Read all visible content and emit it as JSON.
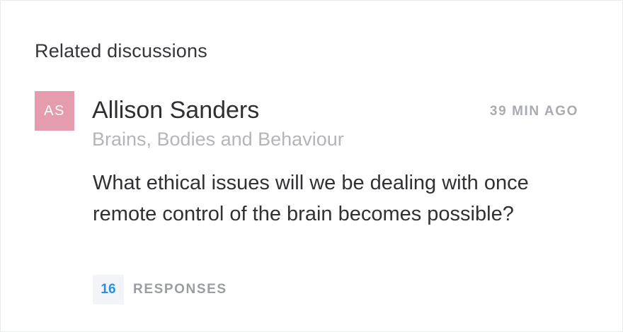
{
  "section": {
    "title": "Related discussions"
  },
  "discussion": {
    "avatar_initials": "AS",
    "avatar_color": "#e59cac",
    "author": "Allison Sanders",
    "time_ago": "39 MIN AGO",
    "category": "Brains, Bodies and Behaviour",
    "question": "What ethical issues will we be dealing with once remote control of the brain becomes possible?",
    "responses_count": "16",
    "responses_label": "RESPONSES"
  },
  "colors": {
    "accent": "#2b8fe0",
    "muted_text": "#a8abb1"
  }
}
